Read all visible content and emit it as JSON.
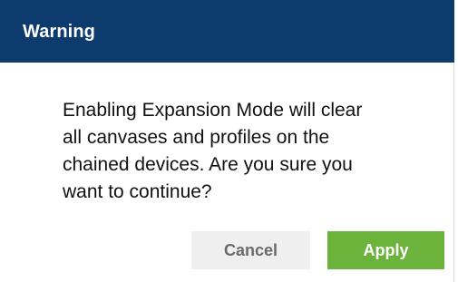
{
  "dialog": {
    "title": "Warning",
    "message": "Enabling Expansion Mode will clear\nall canvases and  profiles on the\nchained devices. Are you sure you\nwant to continue?",
    "buttons": {
      "cancel_label": "Cancel",
      "apply_label": "Apply"
    }
  },
  "colors": {
    "title_bar": "#0e3b6e",
    "apply_button": "#6bb33a",
    "cancel_button": "#efefef"
  }
}
